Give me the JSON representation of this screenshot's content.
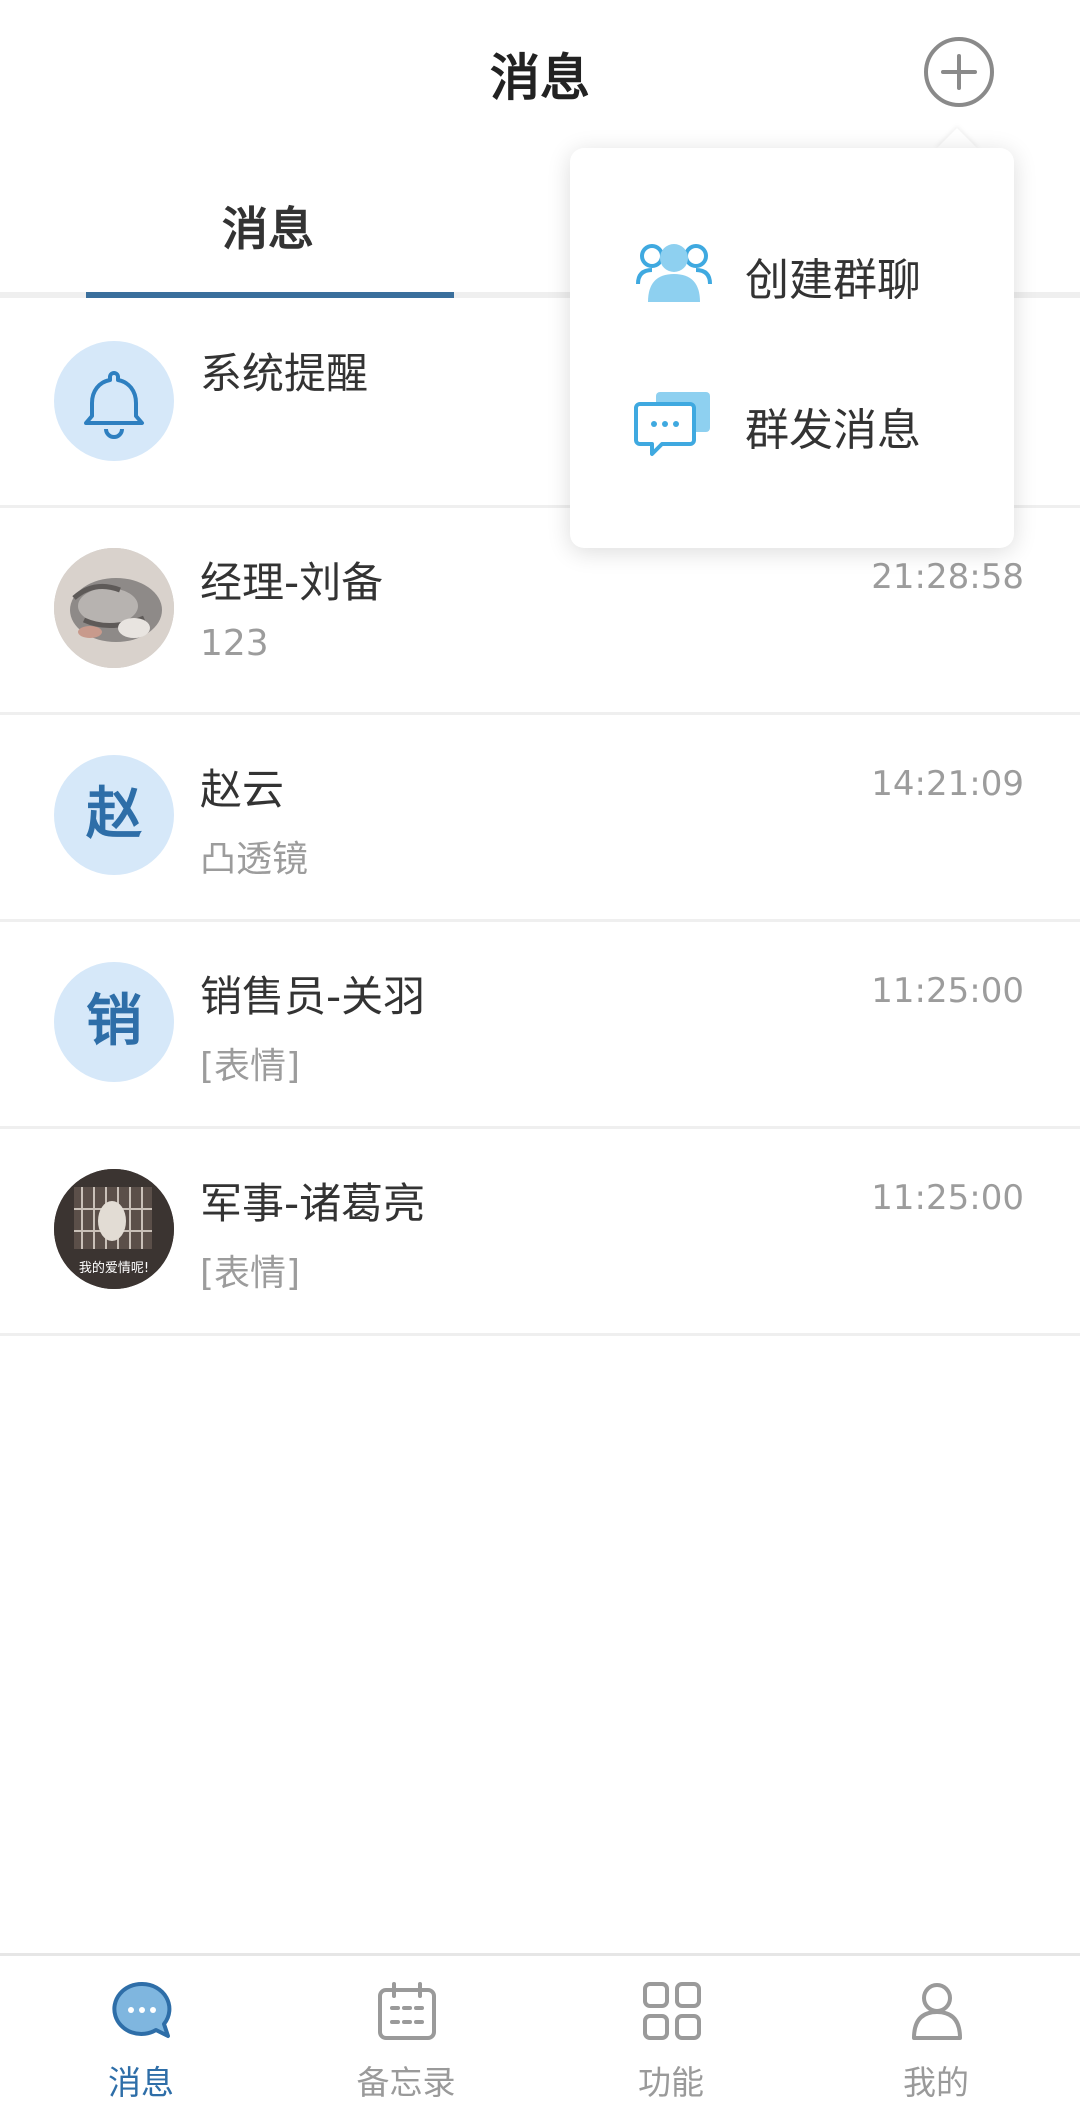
{
  "header": {
    "title": "消息",
    "add_icon": "plus-circle-icon"
  },
  "tabs": [
    {
      "label": "消息",
      "active": true
    }
  ],
  "conversations": [
    {
      "name": "系统提醒",
      "message": "",
      "time": "",
      "avatar": "bell-icon"
    },
    {
      "name": "经理-刘备",
      "message": "123",
      "time": "21:28:58",
      "avatar": "photo-cat"
    },
    {
      "name": "赵云",
      "message": "凸透镜",
      "time": "14:21:09",
      "avatar_text": "赵"
    },
    {
      "name": "销售员-关羽",
      "message": "[表情]",
      "time": "11:25:00",
      "avatar_text": "销"
    },
    {
      "name": "军事-诸葛亮",
      "message": "[表情]",
      "time": "11:25:00",
      "avatar": "photo-cage",
      "avatar_caption": "我的爱情呢!"
    }
  ],
  "popup_menu": {
    "items": [
      {
        "label": "创建群聊",
        "icon": "group-people-icon"
      },
      {
        "label": "群发消息",
        "icon": "broadcast-chat-icon"
      }
    ]
  },
  "bottom_nav": {
    "items": [
      {
        "label": "消息",
        "icon": "chat-bubble-icon",
        "active": true
      },
      {
        "label": "备忘录",
        "icon": "calendar-icon",
        "active": false
      },
      {
        "label": "功能",
        "icon": "grid-icon",
        "active": false
      },
      {
        "label": "我的",
        "icon": "user-icon",
        "active": false
      }
    ]
  },
  "colors": {
    "accent": "#2e6ea8",
    "icon_blue": "#3fa9e0",
    "avatar_bg": "#d6e8f9"
  }
}
